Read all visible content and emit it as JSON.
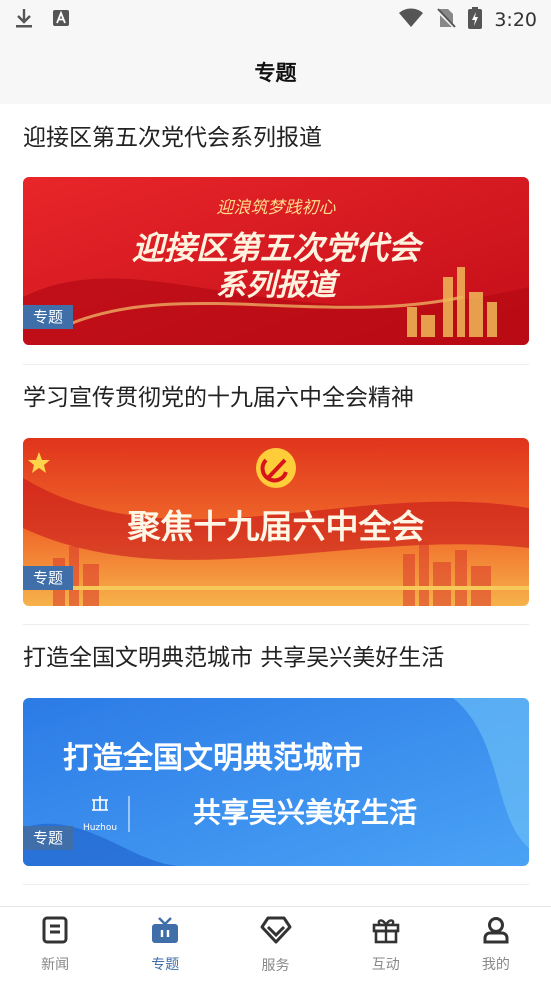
{
  "status": {
    "time": "3:20"
  },
  "header": {
    "title": "专题"
  },
  "topics": [
    {
      "title": "迎接区第五次党代会系列报道",
      "tag": "专题",
      "banner_small": "迎浪筑梦践初心",
      "banner_line1": "迎接区第五次党代会",
      "banner_line2": "系列报道"
    },
    {
      "title": "学习宣传贯彻党的十九届六中全会精神",
      "tag": "专题",
      "banner_line1": "聚焦十九届六中全会"
    },
    {
      "title": "打造全国文明典范城市  共享吴兴美好生活",
      "tag": "专题",
      "banner_line1": "打造全国文明典范城市",
      "banner_line2": "共享吴兴美好生活",
      "banner_logo": "Huzhou"
    }
  ],
  "tabs": [
    {
      "label": "新闻",
      "icon": "news-icon",
      "active": false
    },
    {
      "label": "专题",
      "icon": "topic-icon",
      "active": true
    },
    {
      "label": "服务",
      "icon": "service-icon",
      "active": false
    },
    {
      "label": "互动",
      "icon": "gift-icon",
      "active": false
    },
    {
      "label": "我的",
      "icon": "user-icon",
      "active": false
    }
  ],
  "colors": {
    "accent": "#3f6ea8",
    "banner_red": "#d8141b",
    "banner_blue": "#2f7ee8"
  }
}
